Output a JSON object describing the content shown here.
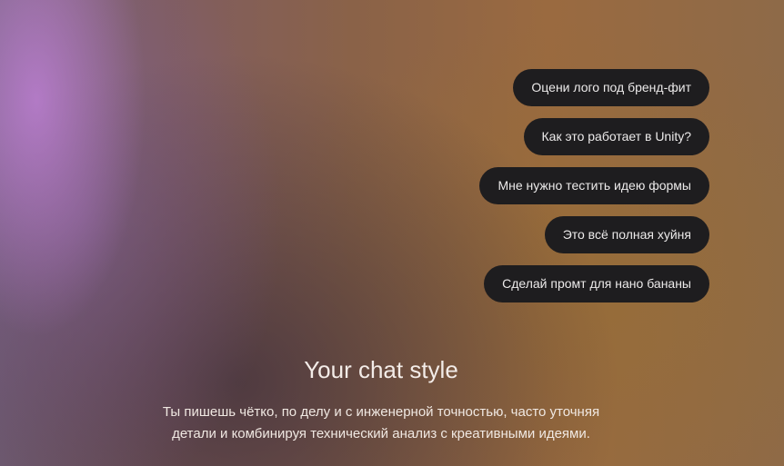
{
  "suggestions": [
    {
      "label": "Оцени лого под бренд-фит"
    },
    {
      "label": "Как это работает в Unity?"
    },
    {
      "label": "Мне нужно тестить идею формы"
    },
    {
      "label": "Это всё полная хуйня"
    },
    {
      "label": "Сделай промт для нано бананы"
    }
  ],
  "style": {
    "title": "Your chat style",
    "description_line1": "Ты пишешь чётко, по делу и с инженерной точностью, часто уточняя",
    "description_line2": "детали и комбинируя технический анализ с креативными идеями."
  }
}
